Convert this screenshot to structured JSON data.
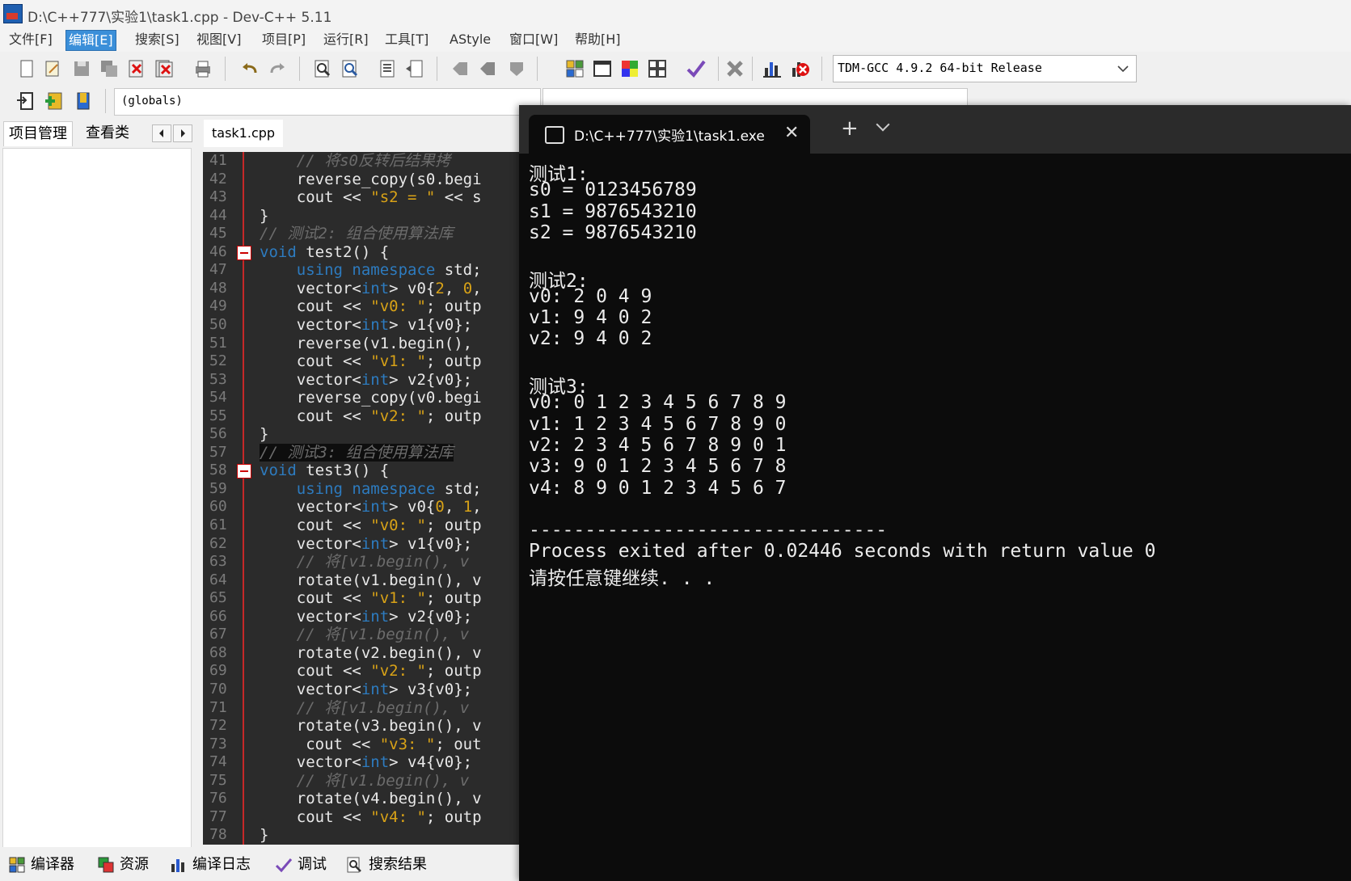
{
  "window": {
    "title": "D:\\C++777\\实验1\\task1.cpp - Dev-C++ 5.11"
  },
  "menu": [
    "文件[F]",
    "编辑[E]",
    "搜索[S]",
    "视图[V]",
    "项目[P]",
    "运行[R]",
    "工具[T]",
    "AStyle",
    "窗口[W]",
    "帮助[H]"
  ],
  "menu_active": "编辑[E]",
  "toolbar": {
    "compiler": "TDM-GCC 4.9.2 64-bit Release",
    "scope": "(globals)"
  },
  "left_panel": {
    "tabs": [
      "项目管理",
      "查看类"
    ]
  },
  "editor": {
    "tab": "task1.cpp",
    "lines": [
      {
        "n": "41",
        "html": "<span class='cm'>    // 将s0反转后结果拷</span>"
      },
      {
        "n": "42",
        "html": "    reverse_copy(s0.begi"
      },
      {
        "n": "43",
        "html": "    cout &lt;&lt; <span class='st'>\"s2 = \"</span> &lt;&lt; s"
      },
      {
        "n": "44",
        "html": "}"
      },
      {
        "n": "45",
        "html": "<span class='cm'>// 测试2: 组合使用算法库</span>"
      },
      {
        "n": "46",
        "html": "<span class='kw'>void</span> test2() {"
      },
      {
        "n": "47",
        "html": "    <span class='kw'>using namespace</span> std;"
      },
      {
        "n": "48",
        "html": "    vector&lt;<span class='kw'>int</span>&gt; v0{<span class='nm'>2</span>, <span class='nm'>0</span>,"
      },
      {
        "n": "49",
        "html": "    cout &lt;&lt; <span class='st'>\"v0: \"</span>; outp"
      },
      {
        "n": "50",
        "html": "    vector&lt;<span class='kw'>int</span>&gt; v1{v0};"
      },
      {
        "n": "51",
        "html": "    reverse(v1.begin(),"
      },
      {
        "n": "52",
        "html": "    cout &lt;&lt; <span class='st'>\"v1: \"</span>; outp"
      },
      {
        "n": "53",
        "html": "    vector&lt;<span class='kw'>int</span>&gt; v2{v0};"
      },
      {
        "n": "54",
        "html": "    reverse_copy(v0.begi"
      },
      {
        "n": "55",
        "html": "    cout &lt;&lt; <span class='st'>\"v2: \"</span>; outp"
      },
      {
        "n": "56",
        "html": "}"
      },
      {
        "n": "57",
        "html": "<span class='cm'>// 测试3: 组合使用算法库</span>",
        "hl": true
      },
      {
        "n": "58",
        "html": "<span class='kw'>void</span> test3() {"
      },
      {
        "n": "59",
        "html": "    <span class='kw'>using namespace</span> std;"
      },
      {
        "n": "60",
        "html": "    vector&lt;<span class='kw'>int</span>&gt; v0{<span class='nm'>0</span>, <span class='nm'>1</span>,"
      },
      {
        "n": "61",
        "html": "    cout &lt;&lt; <span class='st'>\"v0: \"</span>; outp"
      },
      {
        "n": "62",
        "html": "    vector&lt;<span class='kw'>int</span>&gt; v1{v0};"
      },
      {
        "n": "63",
        "html": "<span class='cm'>    // 将[v1.begin(), v</span>"
      },
      {
        "n": "64",
        "html": "    rotate(v1.begin(), v"
      },
      {
        "n": "65",
        "html": "    cout &lt;&lt; <span class='st'>\"v1: \"</span>; outp"
      },
      {
        "n": "66",
        "html": "    vector&lt;<span class='kw'>int</span>&gt; v2{v0};"
      },
      {
        "n": "67",
        "html": "<span class='cm'>    // 将[v1.begin(), v</span>"
      },
      {
        "n": "68",
        "html": "    rotate(v2.begin(), v"
      },
      {
        "n": "69",
        "html": "    cout &lt;&lt; <span class='st'>\"v2: \"</span>; outp"
      },
      {
        "n": "70",
        "html": "    vector&lt;<span class='kw'>int</span>&gt; v3{v0};"
      },
      {
        "n": "71",
        "html": "<span class='cm'>    // 将[v1.begin(), v</span>"
      },
      {
        "n": "72",
        "html": "    rotate(v3.begin(), v"
      },
      {
        "n": "73",
        "html": "     cout &lt;&lt; <span class='st'>\"v3: \"</span>; out"
      },
      {
        "n": "74",
        "html": "    vector&lt;<span class='kw'>int</span>&gt; v4{v0};"
      },
      {
        "n": "75",
        "html": "<span class='cm'>    // 将[v1.begin(), v</span>"
      },
      {
        "n": "76",
        "html": "    rotate(v4.begin(), v"
      },
      {
        "n": "77",
        "html": "    cout &lt;&lt; <span class='st'>\"v4: \"</span>; outp"
      },
      {
        "n": "78",
        "html": "}"
      }
    ]
  },
  "bottom_tabs": [
    "编译器",
    "资源",
    "编译日志",
    "调试",
    "搜索结果"
  ],
  "terminal": {
    "title": "D:\\C++777\\实验1\\task1.exe",
    "lines": [
      "测试1:",
      "s0 = 0123456789",
      "s1 = 9876543210",
      "s2 = 9876543210",
      "",
      "测试2:",
      "v0: 2 0 4 9",
      "v1: 9 4 0 2",
      "v2: 9 4 0 2",
      "",
      "测试3:",
      "v0: 0 1 2 3 4 5 6 7 8 9",
      "v1: 1 2 3 4 5 6 7 8 9 0",
      "v2: 2 3 4 5 6 7 8 9 0 1",
      "v3: 9 0 1 2 3 4 5 6 7 8",
      "v4: 8 9 0 1 2 3 4 5 6 7",
      "",
      "--------------------------------",
      "Process exited after 0.02446 seconds with return value 0",
      "请按任意键继续. . ."
    ]
  }
}
